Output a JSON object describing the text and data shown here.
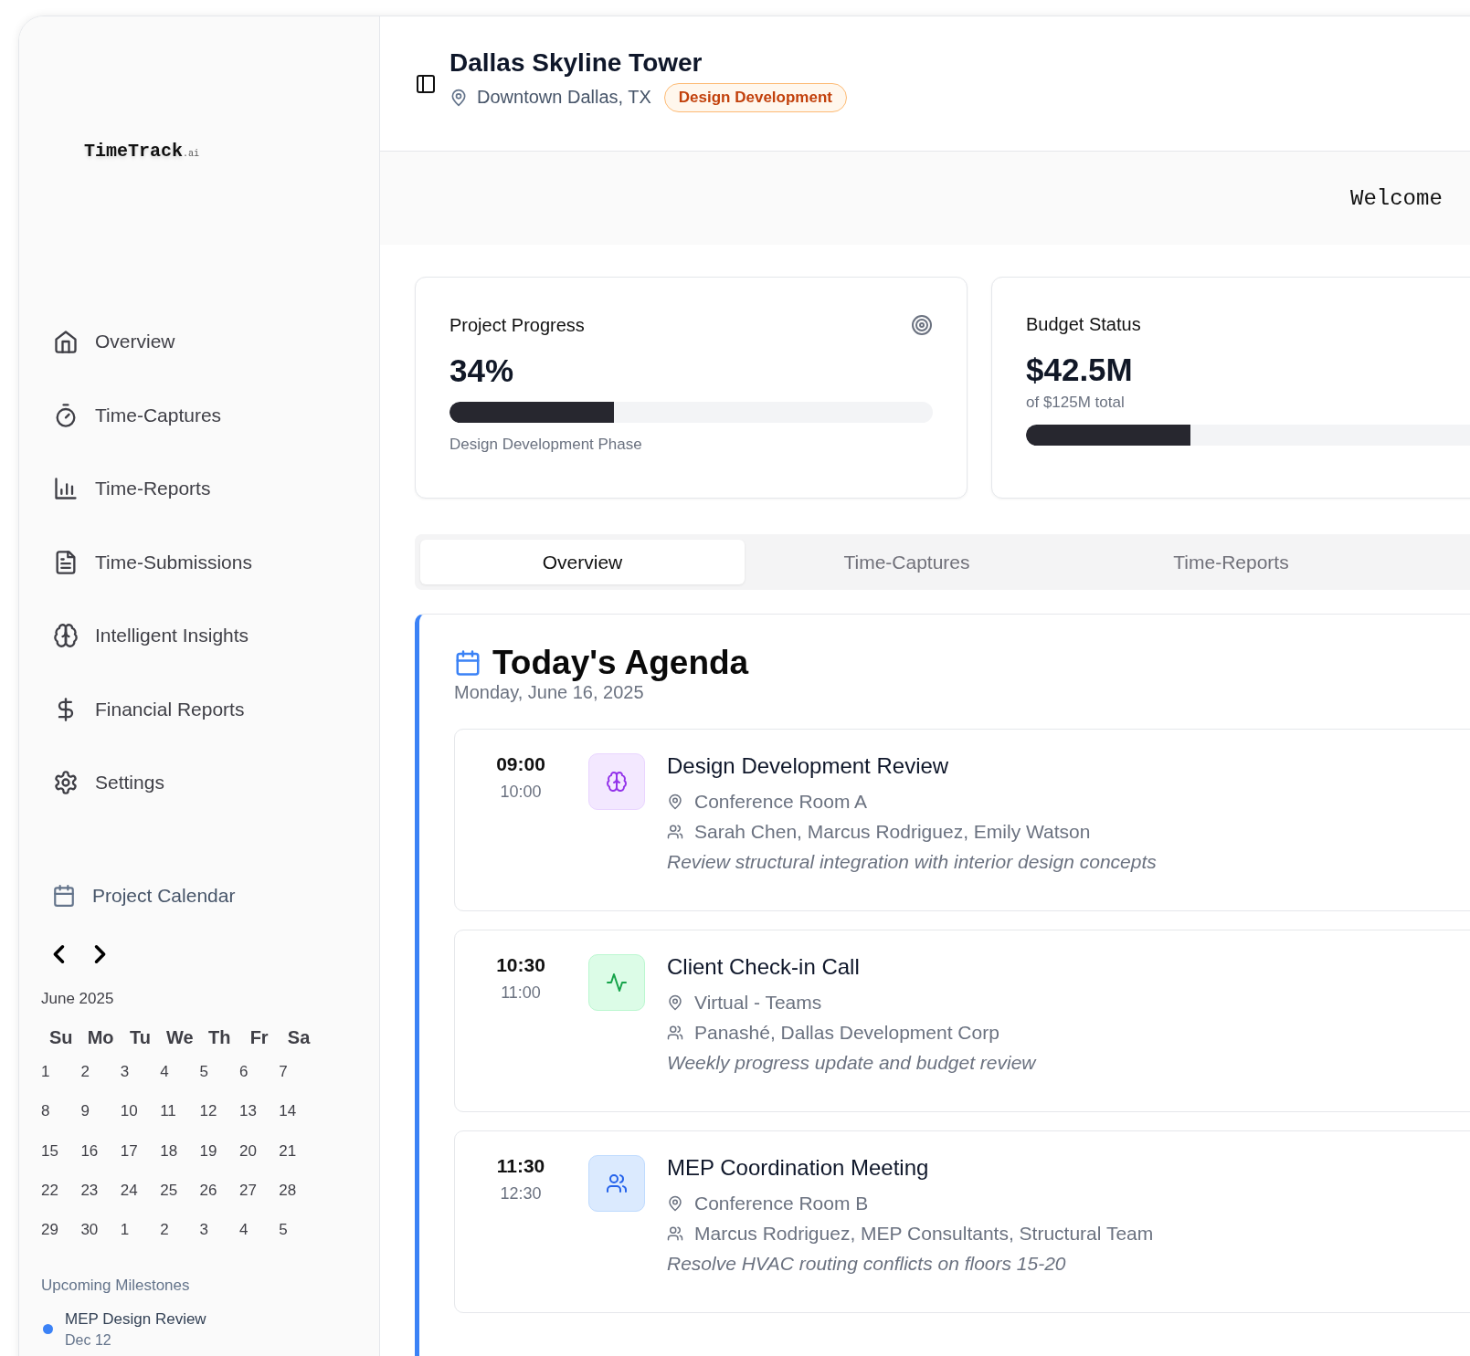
{
  "sidebar": {
    "logo": {
      "name": "TimeTrack",
      "suffix": ".ai"
    },
    "nav": [
      {
        "label": "Overview",
        "kind": "home"
      },
      {
        "label": "Time-Captures",
        "kind": "timer"
      },
      {
        "label": "Time-Reports",
        "kind": "chart"
      },
      {
        "label": "Time-Submissions",
        "kind": "file"
      },
      {
        "label": "Intelligent Insights",
        "kind": "brain"
      },
      {
        "label": "Financial Reports",
        "kind": "dollar"
      },
      {
        "label": "Settings",
        "kind": "gear"
      }
    ],
    "calendar": {
      "title": "Project Calendar",
      "month": "June 2025",
      "weekdays": [
        "Su",
        "Mo",
        "Tu",
        "We",
        "Th",
        "Fr",
        "Sa"
      ],
      "weeks": [
        [
          "1",
          "2",
          "3",
          "4",
          "5",
          "6",
          "7"
        ],
        [
          "8",
          "9",
          "10",
          "11",
          "12",
          "13",
          "14"
        ],
        [
          "15",
          "16",
          "17",
          "18",
          "19",
          "20",
          "21"
        ],
        [
          "22",
          "23",
          "24",
          "25",
          "26",
          "27",
          "28"
        ],
        [
          "29",
          "30",
          "1",
          "2",
          "3",
          "4",
          "5"
        ]
      ]
    },
    "milestones": {
      "title": "Upcoming Milestones",
      "items": [
        {
          "name": "MEP Design Review",
          "date": "Dec 12",
          "color": "#3b82f6"
        }
      ]
    }
  },
  "header": {
    "title": "Dallas Skyline Tower",
    "location": "Downtown Dallas, TX",
    "badge": "Design Development"
  },
  "welcome": "Welcome",
  "cards": [
    {
      "title": "Project Progress",
      "value": "34%",
      "level": 0.34,
      "caption": "Design Development Phase",
      "kind": "progress"
    },
    {
      "title": "Budget Status",
      "value": "$42.5M",
      "subtitle": "of $125M total",
      "level": 0.34,
      "kind": "budget"
    }
  ],
  "tabs": [
    {
      "label": "Overview",
      "selected": true
    },
    {
      "label": "Time-Captures",
      "selected": false
    },
    {
      "label": "Time-Reports",
      "selected": false
    }
  ],
  "agenda": {
    "title": "Today's Agenda",
    "date": "Monday, June 16, 2025",
    "events": [
      {
        "start": "09:00",
        "end": "10:00",
        "kind": "insight",
        "title": "Design Development Review",
        "location": "Conference Room A",
        "attendees": "Sarah Chen, Marcus Rodriguez, Emily Watson",
        "note": "Review structural integration with interior design concepts"
      },
      {
        "start": "10:30",
        "end": "11:00",
        "kind": "call",
        "title": "Client Check-in Call",
        "location": "Virtual - Teams",
        "attendees": "Panashé, Dallas Development Corp",
        "note": "Weekly progress update and budget review"
      },
      {
        "start": "11:30",
        "end": "12:30",
        "kind": "meeting",
        "title": "MEP Coordination Meeting",
        "location": "Conference Room B",
        "attendees": "Marcus Rodriguez, MEP Consultants, Structural Team",
        "note": "Resolve HVAC routing conflicts on floors 15-20"
      }
    ]
  }
}
